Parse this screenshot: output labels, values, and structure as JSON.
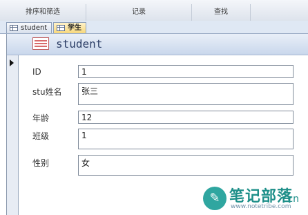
{
  "ribbon": {
    "groups": [
      "排序和筛选",
      "记录",
      "查找"
    ]
  },
  "tabs": [
    {
      "label": "student",
      "icon": "table-icon"
    },
    {
      "label": "学生",
      "icon": "form-icon",
      "active": true
    }
  ],
  "form": {
    "title": "student",
    "fields": [
      {
        "label": "ID",
        "value": "1"
      },
      {
        "label": "stu姓名",
        "value": "张三"
      },
      {
        "label": "年龄",
        "value": "12"
      },
      {
        "label": "班级",
        "value": "1"
      },
      {
        "label": "性别",
        "value": "女"
      }
    ]
  },
  "watermark": {
    "title": "笔记部落",
    "suffix": ".cn",
    "url": "www.notetribe.com"
  }
}
